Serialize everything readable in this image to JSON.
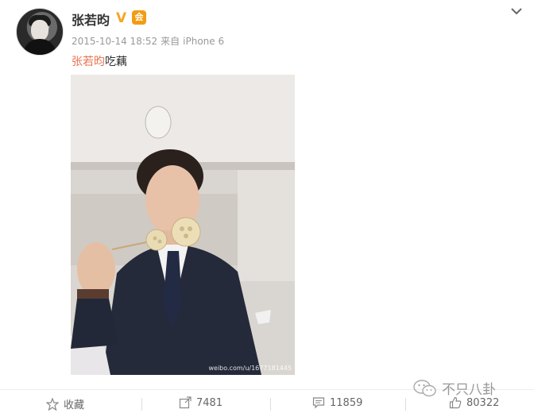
{
  "post": {
    "username": "张若昀",
    "verified_badge": "V",
    "vip_badge": "会",
    "date": "2015-10-14 18:52",
    "source_prefix": "来自",
    "source": "iPhone 6",
    "text_mention": "张若昀",
    "text_body": "吃藕",
    "photo_watermark": "weibo.com/u/1677181445"
  },
  "actions": {
    "favorite_label": "收藏",
    "repost_count": "7481",
    "comment_count": "11859",
    "like_count": "80322"
  },
  "overlay": {
    "channel_name": "不只八卦"
  },
  "icons": {
    "menu": "chevron-down-icon",
    "favorite": "star-icon",
    "repost": "repost-icon",
    "comment": "comment-icon",
    "like": "thumbs-up-icon",
    "channel": "wechat-icon"
  },
  "colors": {
    "mention": "#eb7350",
    "verified": "#f5a623",
    "meta": "#999999"
  }
}
